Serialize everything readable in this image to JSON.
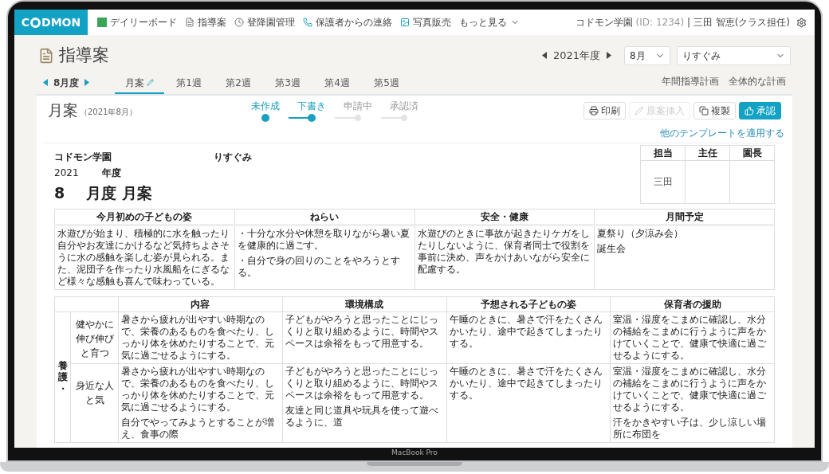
{
  "laptop": {
    "label": "MacBook Pro"
  },
  "nav": {
    "logo": {
      "before": "C",
      "after": "DMON"
    },
    "items": [
      {
        "label": "デイリーボード",
        "kind": "board"
      },
      {
        "label": "指導案",
        "kind": "doc"
      },
      {
        "label": "登降園管理",
        "kind": "clock"
      },
      {
        "label": "保護者からの連絡",
        "kind": "phone"
      },
      {
        "label": "写真販売",
        "kind": "photo"
      },
      {
        "label": "もっと見る",
        "kind": "more"
      }
    ],
    "account": {
      "school": "コドモン学園",
      "id": "(ID: 1234)",
      "user": "| 三田 智恵(クラス担任)"
    }
  },
  "header": {
    "title": "指導案",
    "year": "2021年度",
    "month_select": "8月",
    "class_select": "りすぐみ"
  },
  "period": {
    "label": "8月度",
    "tabs": [
      {
        "label": "月案",
        "selected": true
      },
      {
        "label": "第1週",
        "selected": false
      },
      {
        "label": "第2週",
        "selected": false
      },
      {
        "label": "第3週",
        "selected": false
      },
      {
        "label": "第4週",
        "selected": false
      },
      {
        "label": "第5週",
        "selected": false
      }
    ],
    "links": [
      "年間指導計画",
      "全体的な計画"
    ]
  },
  "plan": {
    "title": "月案",
    "subtitle": "（2021年8月）",
    "steps": [
      {
        "label": "未作成",
        "completed": true
      },
      {
        "label": "下書き",
        "completed": true
      },
      {
        "label": "申請中",
        "completed": false
      },
      {
        "label": "承認済",
        "completed": false
      }
    ],
    "buttons": [
      {
        "label": "印刷",
        "kind": "print",
        "disabled": false
      },
      {
        "label": "原案挿入",
        "kind": "edit",
        "disabled": true
      },
      {
        "label": "複製",
        "kind": "copy",
        "disabled": false
      },
      {
        "label": "承認",
        "kind": "approve",
        "disabled": false
      }
    ],
    "template_link": "他のテンプレートを適用する"
  },
  "document": {
    "school": "コドモン学園",
    "class": "りすぐみ",
    "year": "2021",
    "year_unit": "年度",
    "month": "8",
    "month_title": "月度 月案",
    "stamps": [
      {
        "role": "担当",
        "name": "三田"
      },
      {
        "role": "主任"
      },
      {
        "role": "園長"
      }
    ],
    "overview": {
      "columns": [
        "今月初めの子どもの姿",
        "ねらい",
        "安全・健康",
        "月間予定"
      ],
      "cells": [
        [
          "水遊びが始まり、積極的に水を触ったり自分やお友達にかけるなど気持ちよさそうに水の感触を楽しむ姿が見られる。また、泥団子を作ったり水風船をにぎるなど様々な感触も喜んで味わっている。"
        ],
        [
          "・十分な水分や休憩を取りながら暑い夏を健康的に過ごす。",
          "・自分で身の回りのことをやろうとする。"
        ],
        [
          "水遊びのときに事故が起きたりケガをしたりしないように、保育者同士で役割を事前に決め、声をかけあいながら安全に配慮する。"
        ],
        [
          "夏祭り（夕涼み会）",
          "誕生会"
        ]
      ]
    },
    "plan_table": {
      "columns": [
        "内容",
        "環境構成",
        "予想される子どもの姿",
        "保育者の援助"
      ],
      "category": "養護・",
      "rows": [
        {
          "label": "健やかに伸び伸びと育つ",
          "cells": [
            [
              "暑さから疲れが出やすい時期なので、栄養のあるものを食べたり、しっかり体を休めたりすることで、元気に過ごせるようにする。"
            ],
            [
              "子どもがやろうと思ったことにじっくりと取り組めるように、時間やスペースは余裕をもって用意する。"
            ],
            [
              "午睡のときに、暑さで汗をたくさんかいたり、途中で起きてしまったりする。"
            ],
            [
              "室温・湿度をこまめに確認し、水分の補給をこまめに行うように声をかけていくことで、健康で快適に過ごせるようにする。"
            ]
          ]
        },
        {
          "label": "身近な人と気",
          "cells": [
            [
              "暑さから疲れが出やすい時期なので、栄養のあるものを食べたり、しっかり体を休めたりすることで、元気に過ごせるようにする。",
              "自分でやってみようとすることが増え、食事の際"
            ],
            [
              "子どもがやろうと思ったことにじっくりと取り組めるように、時間やスペースは余裕をもって用意する。",
              "友達と同じ道具や玩具を使って遊べるように、道"
            ],
            [
              "午睡のときに、暑さで汗をたくさんかいたり、途中で起きてしまったりする。"
            ],
            [
              "室温・湿度をこまめに確認し、水分の補給をこまめに行うように声をかけていくことで、健康で快適に過ごせるようにする。",
              "汗をかきやすい子は、少し涼しい場所に布団を"
            ]
          ]
        }
      ]
    }
  }
}
